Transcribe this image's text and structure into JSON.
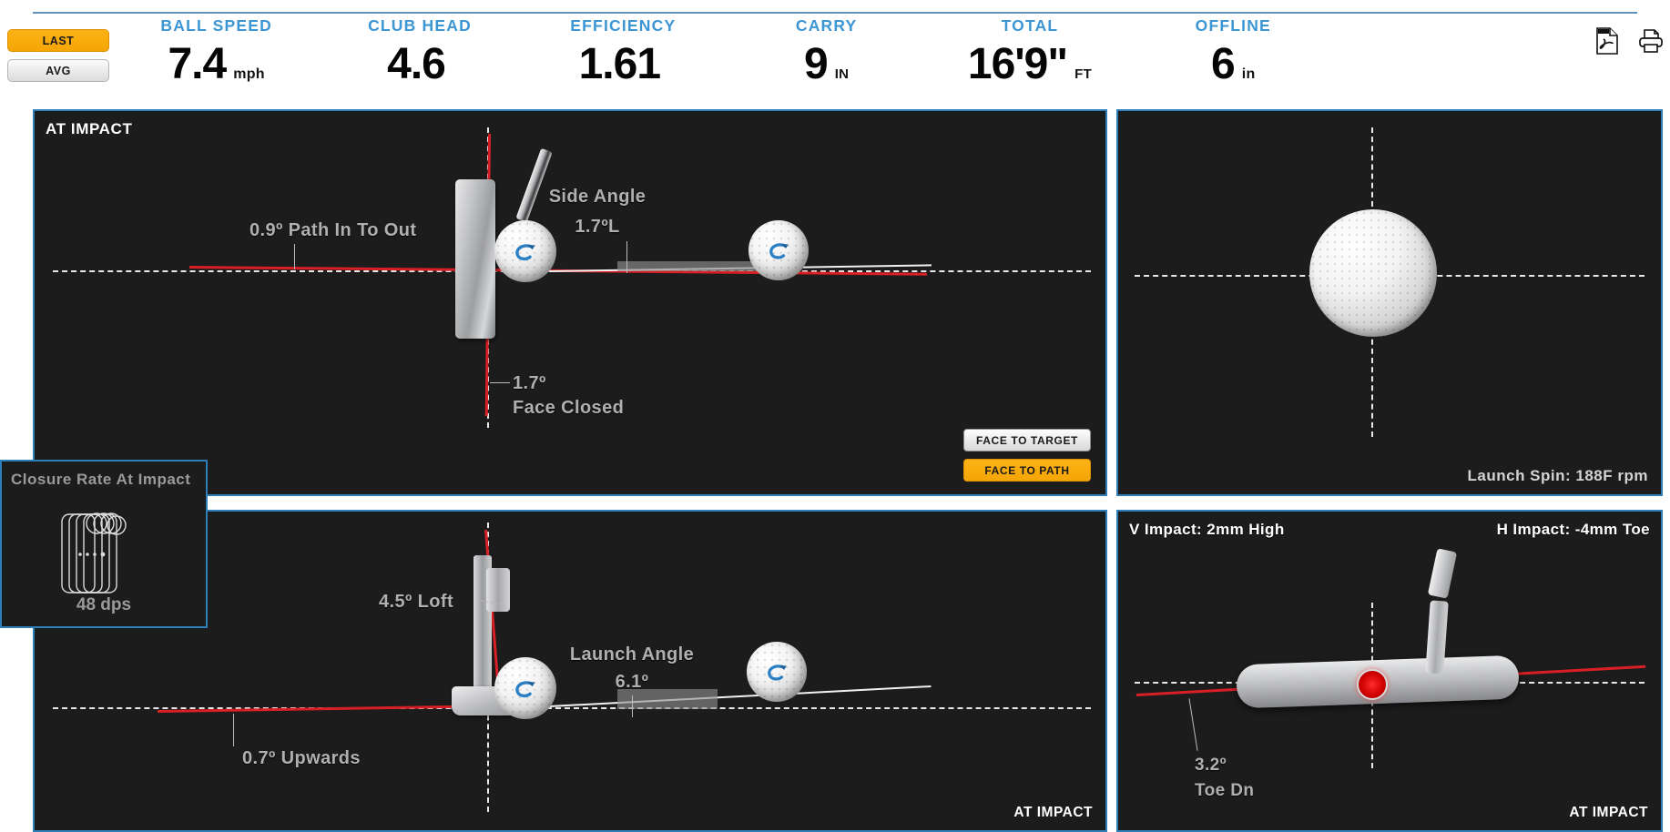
{
  "header": {
    "toggles": [
      {
        "label": "LAST",
        "active": true
      },
      {
        "label": "AVG",
        "active": false
      }
    ],
    "metrics": [
      {
        "label": "BALL SPEED",
        "value": "7.4",
        "unit": "mph"
      },
      {
        "label": "CLUB HEAD",
        "value": "4.6",
        "unit": ""
      },
      {
        "label": "EFFICIENCY",
        "value": "1.61",
        "unit": ""
      },
      {
        "label": "CARRY",
        "value": "9",
        "unit": "IN"
      },
      {
        "label": "TOTAL",
        "value": "16'9\"",
        "unit": "FT"
      },
      {
        "label": "OFFLINE",
        "value": "6",
        "unit": "in"
      }
    ],
    "icons": [
      {
        "name": "pdf-icon",
        "title": "Export PDF"
      },
      {
        "name": "print-icon",
        "title": "Print"
      }
    ],
    "accent_blue": "#3d96d4",
    "accent_amber": "#f5a505"
  },
  "panels": {
    "impact_face": {
      "title": "AT IMPACT",
      "path_label": "0.9º Path In To Out",
      "side_angle_label": "Side Angle",
      "side_angle_value": "1.7ºL",
      "face_angle_value": "1.7º",
      "face_angle_label": "Face Closed",
      "buttons": [
        {
          "label": "FACE TO TARGET",
          "active": false
        },
        {
          "label": "FACE TO PATH",
          "active": true
        }
      ]
    },
    "ball_launch": {
      "launch_spin": "Launch Spin: 188F rpm"
    },
    "impact_loft": {
      "loft_label": "4.5º Loft",
      "launch_angle_label": "Launch Angle",
      "launch_angle_value": "6.1º",
      "attack_label": "0.7º Upwards",
      "corner_label": "AT IMPACT"
    },
    "impact_head": {
      "v_impact": "V Impact: 2mm High",
      "h_impact": "H Impact: -4mm Toe",
      "lie_value": "3.2º",
      "lie_label": "Toe Dn",
      "corner_label": "AT IMPACT"
    }
  },
  "tooltip": {
    "title": "Closure Rate At Impact",
    "value": "48 dps"
  },
  "colors": {
    "panel_bg": "#1c1c1c",
    "panel_border": "#2d7fb8",
    "red_line": "#d81f26",
    "annotation_gray": "#b0b0b0"
  }
}
